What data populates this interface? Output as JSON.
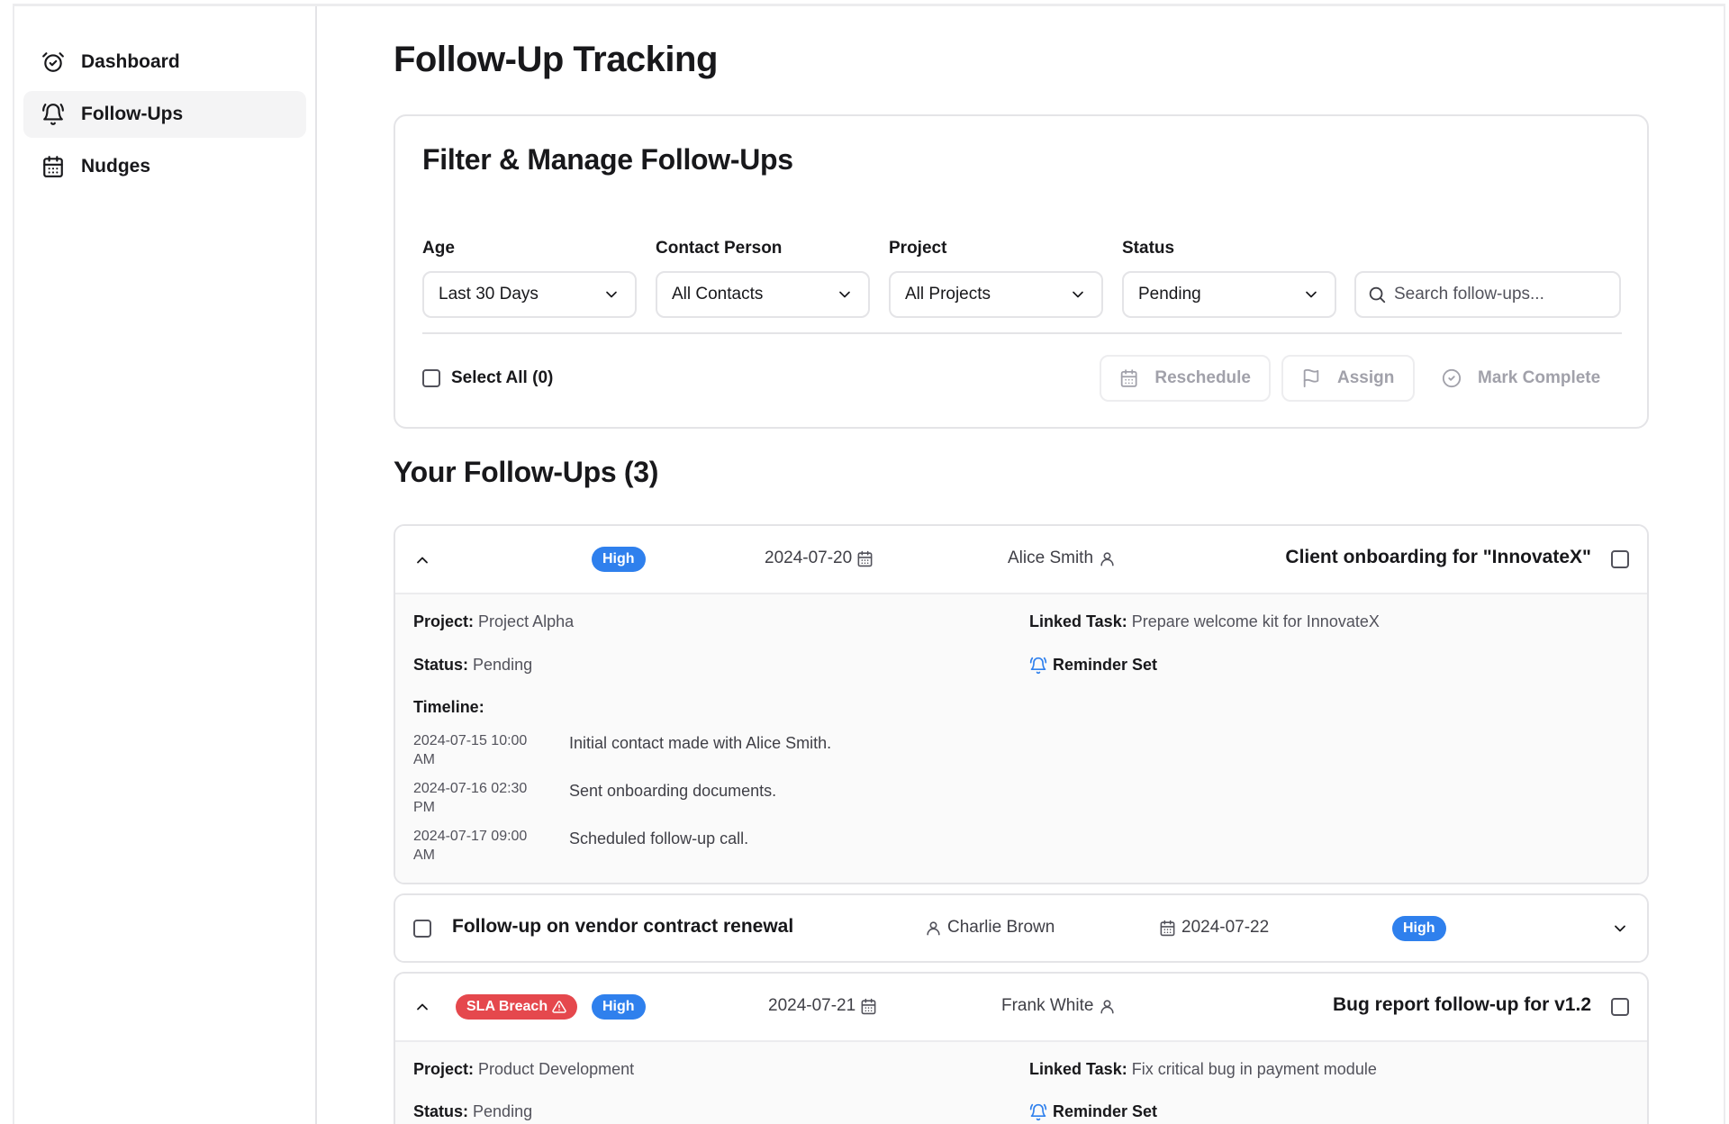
{
  "sidebar": {
    "items": [
      {
        "label": "Dashboard",
        "icon": "alarm-clock-check-icon",
        "active": false
      },
      {
        "label": "Follow-Ups",
        "icon": "bell-ring-icon",
        "active": true
      },
      {
        "label": "Nudges",
        "icon": "calendar-days-icon",
        "active": false
      }
    ]
  },
  "page": {
    "title": "Follow-Up Tracking"
  },
  "filters": {
    "title": "Filter & Manage Follow-Ups",
    "age": {
      "label": "Age",
      "value": "Last 30 Days"
    },
    "contact": {
      "label": "Contact Person",
      "value": "All Contacts"
    },
    "project": {
      "label": "Project",
      "value": "All Projects"
    },
    "status": {
      "label": "Status",
      "value": "Pending"
    },
    "search": {
      "placeholder": "Search follow-ups..."
    },
    "select_all": "Select All (0)",
    "actions": {
      "reschedule": "Reschedule",
      "assign": "Assign",
      "mark_complete": "Mark Complete"
    }
  },
  "list": {
    "title": "Your Follow-Ups (3)",
    "items": [
      {
        "title": "Client onboarding for \"InnovateX\"",
        "priority": "High",
        "date": "2024-07-20",
        "contact": "Alice Smith",
        "expanded": true,
        "project_label": "Project:",
        "project": "Project Alpha",
        "status_label": "Status:",
        "status": "Pending",
        "task_label": "Linked Task:",
        "task": "Prepare welcome kit for InnovateX",
        "reminder": "Reminder Set",
        "timeline_label": "Timeline:",
        "timeline": [
          {
            "time1": "2024-07-15 10:00",
            "time2": "AM",
            "text": "Initial contact made with Alice Smith."
          },
          {
            "time1": "2024-07-16 02:30",
            "time2": "PM",
            "text": "Sent onboarding documents."
          },
          {
            "time1": "2024-07-17 09:00",
            "time2": "AM",
            "text": "Scheduled follow-up call."
          }
        ]
      },
      {
        "title": "Follow-up on vendor contract renewal",
        "priority": "High",
        "date": "2024-07-22",
        "contact": "Charlie Brown",
        "expanded": false
      },
      {
        "title": "Bug report follow-up for v1.2",
        "priority": "High",
        "sla": "SLA Breach",
        "date": "2024-07-21",
        "contact": "Frank White",
        "expanded": true,
        "project_label": "Project:",
        "project": "Product Development",
        "status_label": "Status:",
        "status": "Pending",
        "task_label": "Linked Task:",
        "task": "Fix critical bug in payment module",
        "reminder": "Reminder Set"
      }
    ]
  },
  "colors": {
    "accent": "#2f80ed",
    "breach": "#e5484d",
    "reminder": "#2f80ed"
  }
}
